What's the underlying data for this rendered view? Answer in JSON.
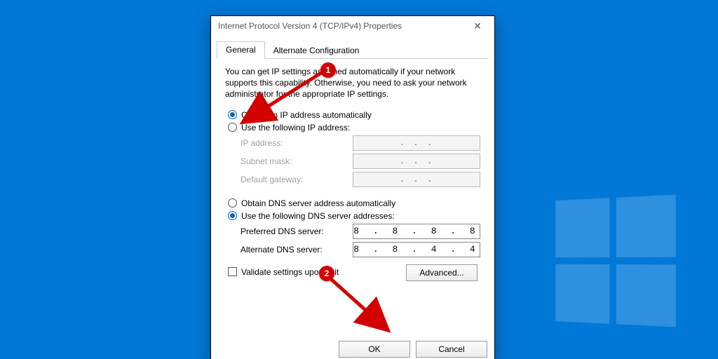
{
  "window": {
    "title": "Internet Protocol Version 4 (TCP/IPv4) Properties"
  },
  "tabs": {
    "general": "General",
    "alternate": "Alternate Configuration"
  },
  "intro": "You can get IP settings assigned automatically if your network supports this capability. Otherwise, you need to ask your network administrator for the appropriate IP settings.",
  "ip": {
    "auto": "Obtain an IP address automatically",
    "manual": "Use the following IP address:",
    "fields": {
      "address": "IP address:",
      "subnet": "Subnet mask:",
      "gateway": "Default gateway:"
    },
    "placeholder": ".     .     ."
  },
  "dns": {
    "auto": "Obtain DNS server address automatically",
    "manual": "Use the following DNS server addresses:",
    "fields": {
      "preferred": "Preferred DNS server:",
      "alternate": "Alternate DNS server:"
    },
    "values": {
      "preferred": "8 . 8 . 8 . 8",
      "alternate": "8 . 8 . 4 . 4"
    }
  },
  "validate": "Validate settings upon exit",
  "buttons": {
    "advanced": "Advanced...",
    "ok": "OK",
    "cancel": "Cancel"
  },
  "callouts": {
    "one": "1",
    "two": "2"
  }
}
